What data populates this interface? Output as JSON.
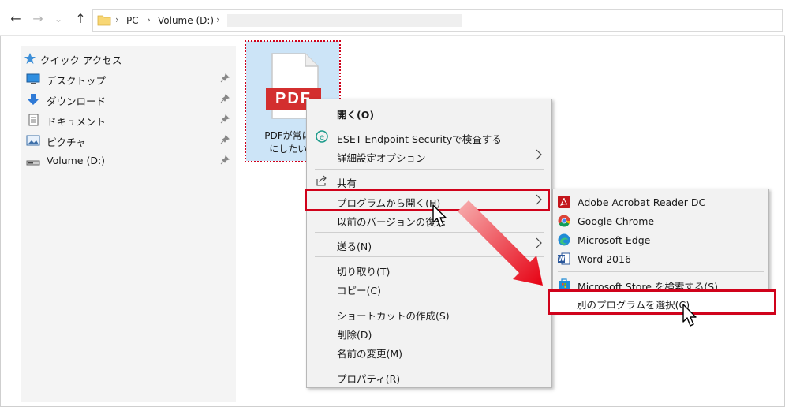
{
  "nav": {
    "back": "←",
    "forward": "→",
    "down": "⌄",
    "up": "↑",
    "breadcrumb": [
      "PC",
      "Volume (D:)"
    ],
    "sep": "›"
  },
  "sidebar": {
    "quick_access": "クイック アクセス",
    "items": [
      {
        "label": "デスクトップ",
        "icon": "desktop-icon"
      },
      {
        "label": "ダウンロード",
        "icon": "download-icon"
      },
      {
        "label": "ドキュメント",
        "icon": "document-icon"
      },
      {
        "label": "ピクチャ",
        "icon": "picture-icon"
      },
      {
        "label": "Volume (D:)",
        "icon": "drive-icon"
      }
    ]
  },
  "file": {
    "badge": "PDF",
    "name_line1": "PDFが常に開",
    "name_line2": "にしたい.p"
  },
  "context_menu": {
    "open": "開く(O)",
    "eset": "ESET Endpoint Securityで検査する",
    "advanced": "詳細設定オプション",
    "share": "共有",
    "open_with": "プログラムから開く(H)",
    "restore": "以前のバージョンの復元",
    "send_to": "送る(N)",
    "cut": "切り取り(T)",
    "copy": "コピー(C)",
    "shortcut": "ショートカットの作成(S)",
    "delete": "削除(D)",
    "rename": "名前の変更(M)",
    "properties": "プロパティ(R)"
  },
  "submenu": {
    "items": [
      "Adobe Acrobat Reader DC",
      "Google Chrome",
      "Microsoft Edge",
      "Word 2016"
    ],
    "store": "Microsoft Store を検索する(S)",
    "choose": "別のプログラムを選択(C)"
  },
  "colors": {
    "highlight": "#d0021b",
    "tile_selected": "#cce4f7",
    "menu_bg": "#f2f2f2"
  }
}
